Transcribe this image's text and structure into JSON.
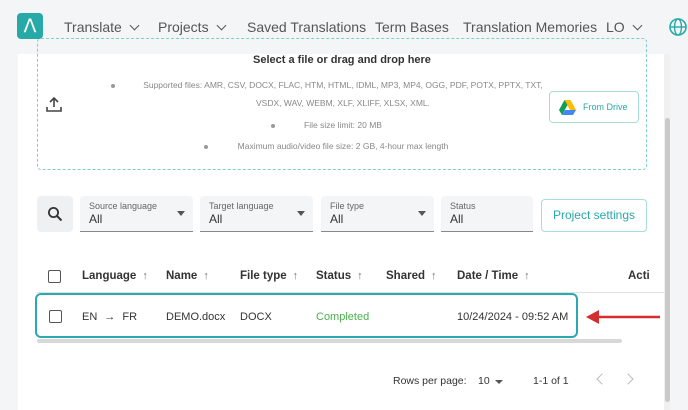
{
  "nav": {
    "logo_glyph": "Λ",
    "items": [
      {
        "label": "Translate"
      },
      {
        "label": "Projects"
      },
      {
        "label": "Saved Translations"
      },
      {
        "label": "Term Bases"
      },
      {
        "label": "Translation Memories"
      },
      {
        "label": "LO"
      }
    ],
    "globe_icon": "globe-icon"
  },
  "upload": {
    "title": "Select a file or drag and drop here",
    "supported_line1": "Supported files: AMR, CSV, DOCX, FLAC, HTM, HTML, IDML, MP3, MP4, OGG, PDF, POTX, PPTX, TXT,",
    "supported_line2": "VSDX, WAV, WEBM, XLF, XLIFF, XLSX, XML.",
    "size_limit": "File size limit: 20 MB",
    "av_limit": "Maximum audio/video file size: 2 GB, 4-hour max length",
    "drive_button": "From Drive"
  },
  "filters": {
    "source": {
      "label": "Source language",
      "value": "All"
    },
    "target": {
      "label": "Target language",
      "value": "All"
    },
    "file_type": {
      "label": "File type",
      "value": "All"
    },
    "status": {
      "label": "Status",
      "value": "All"
    },
    "project_settings": "Project settings"
  },
  "table": {
    "columns": [
      "Language",
      "Name",
      "File type",
      "Status",
      "Shared",
      "Date / Time",
      "Acti"
    ],
    "sort_arrow": "↑",
    "rows": [
      {
        "source": "EN",
        "arrow": "→",
        "target": "FR",
        "name": "DEMO.docx",
        "file_type": "DOCX",
        "status": "Completed",
        "shared": "",
        "datetime": "10/24/2024 - 09:52 AM"
      }
    ]
  },
  "pagination": {
    "rows_per_page_label": "Rows per page:",
    "rows_per_page": "10",
    "range": "1-1 of 1"
  },
  "colors": {
    "accent": "#27a9a8",
    "completed": "#4caf50",
    "annotation_arrow": "#d32f2f",
    "highlight_border": "#2aa9b0"
  }
}
